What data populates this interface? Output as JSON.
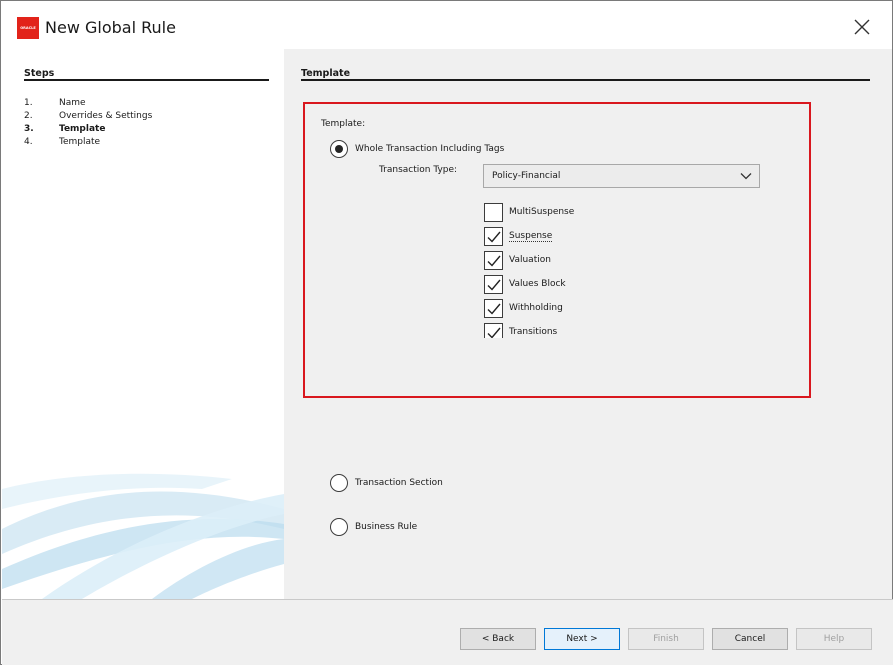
{
  "window": {
    "title": "New Global Rule",
    "logo_text": "ORACLE",
    "colors": {
      "accent": "#0078d7",
      "highlight_border": "#d9171e",
      "logo": "#e2231a"
    }
  },
  "steps": {
    "header": "Steps",
    "items": [
      {
        "num": "1.",
        "label": "Name"
      },
      {
        "num": "2.",
        "label": "Overrides & Settings"
      },
      {
        "num": "3.",
        "label": "Template"
      },
      {
        "num": "4.",
        "label": "Template"
      }
    ],
    "current_index": 2
  },
  "main": {
    "header": "Template",
    "template_label": "Template:",
    "radio_whole": "Whole Transaction Including Tags",
    "transaction_type_label": "Transaction Type:",
    "transaction_type_value": "Policy-Financial",
    "checkboxes": [
      {
        "label": "MultiSuspense",
        "checked": false
      },
      {
        "label": "Suspense",
        "checked": true
      },
      {
        "label": "Valuation",
        "checked": true
      },
      {
        "label": "Values Block",
        "checked": true
      },
      {
        "label": "Withholding",
        "checked": true
      },
      {
        "label": "Transitions",
        "checked": true
      }
    ],
    "radio_section": "Transaction Section",
    "radio_business": "Business Rule",
    "selected_radio": "whole"
  },
  "footer": {
    "back": "< Back",
    "next": "Next >",
    "finish": "Finish",
    "cancel": "Cancel",
    "help": "Help"
  }
}
